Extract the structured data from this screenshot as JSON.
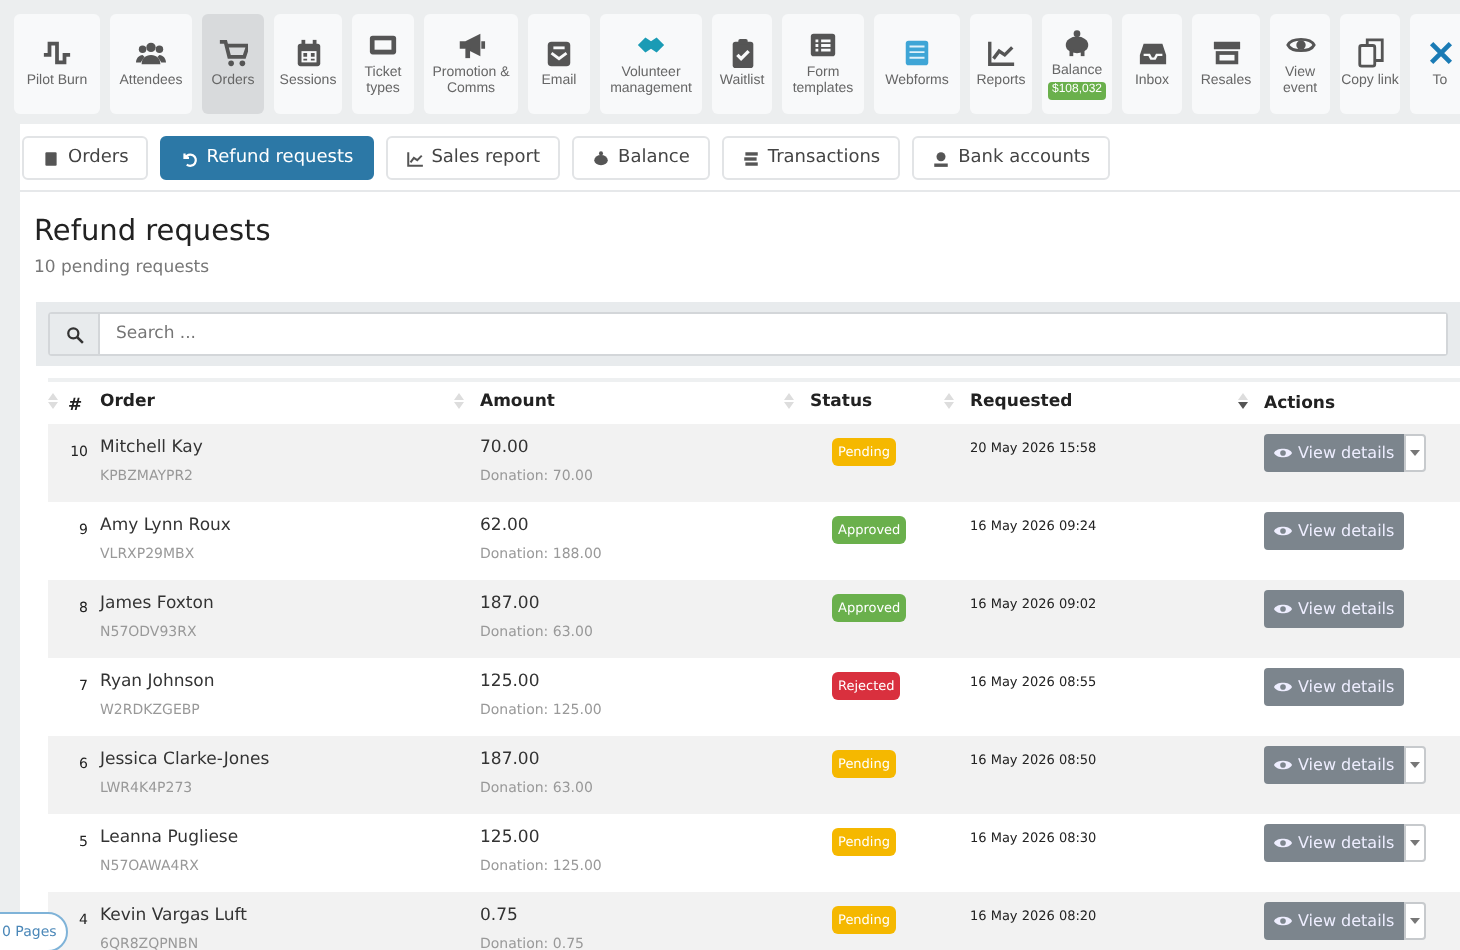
{
  "toolbar": [
    {
      "label": "Pilot Burn",
      "selected": false
    },
    {
      "label": "Attendees",
      "selected": false
    },
    {
      "label": "Orders",
      "selected": true
    },
    {
      "label": "Sessions",
      "selected": false
    },
    {
      "label": "Ticket types",
      "selected": false
    },
    {
      "label": "Promotion & Comms",
      "selected": false
    },
    {
      "label": "Email",
      "selected": false
    },
    {
      "label": "Volunteer management",
      "selected": false
    },
    {
      "label": "Waitlist",
      "selected": false
    },
    {
      "label": "Form templates",
      "selected": false
    },
    {
      "label": "Webforms",
      "selected": false
    },
    {
      "label": "Reports",
      "selected": false
    },
    {
      "label": "Balance",
      "badge": "$108,032",
      "selected": false
    },
    {
      "label": "Inbox",
      "selected": false
    },
    {
      "label": "Resales",
      "selected": false
    },
    {
      "label": "View event",
      "selected": false
    },
    {
      "label": "Copy link",
      "selected": false
    },
    {
      "label": "To",
      "selected": false
    }
  ],
  "tabs": [
    {
      "label": "Orders",
      "selected": false
    },
    {
      "label": "Refund requests",
      "selected": true
    },
    {
      "label": "Sales report",
      "selected": false
    },
    {
      "label": "Balance",
      "selected": false
    },
    {
      "label": "Transactions",
      "selected": false
    },
    {
      "label": "Bank accounts",
      "selected": false
    }
  ],
  "page": {
    "title": "Refund requests",
    "subtitle": "10 pending requests"
  },
  "search": {
    "placeholder": "Search ..."
  },
  "table": {
    "columns": [
      {
        "label": "#",
        "sortable": true,
        "sorted": false
      },
      {
        "label": "Order",
        "sortable": true,
        "sorted": false
      },
      {
        "label": "Amount",
        "sortable": true,
        "sorted": false
      },
      {
        "label": "Status",
        "sortable": true,
        "sorted": false
      },
      {
        "label": "Requested",
        "sortable": true,
        "sorted": true
      },
      {
        "label": "Actions",
        "sortable": false
      }
    ],
    "rows": [
      {
        "number": "10",
        "name": "Mitchell Kay",
        "code": "KPBZMAYPR2",
        "amount": "70.00",
        "donation": "Donation: 70.00",
        "status": "Pending",
        "kind": "pending",
        "requested": "20 May 2026 15:58",
        "action": "View details",
        "dropdown": true
      },
      {
        "number": "9",
        "name": "Amy Lynn Roux",
        "code": "VLRXP29MBX",
        "amount": "62.00",
        "donation": "Donation: 188.00",
        "status": "Approved",
        "kind": "approved",
        "requested": "16 May 2026 09:24",
        "action": "View details",
        "dropdown": false
      },
      {
        "number": "8",
        "name": "James Foxton",
        "code": "N57ODV93RX",
        "amount": "187.00",
        "donation": "Donation: 63.00",
        "status": "Approved",
        "kind": "approved",
        "requested": "16 May 2026 09:02",
        "action": "View details",
        "dropdown": false
      },
      {
        "number": "7",
        "name": "Ryan Johnson",
        "code": "W2RDKZGEBP",
        "amount": "125.00",
        "donation": "Donation: 125.00",
        "status": "Rejected",
        "kind": "rejected",
        "requested": "16 May 2026 08:55",
        "action": "View details",
        "dropdown": false
      },
      {
        "number": "6",
        "name": "Jessica Clarke-Jones",
        "code": "LWR4K4P273",
        "amount": "187.00",
        "donation": "Donation: 63.00",
        "status": "Pending",
        "kind": "pending",
        "requested": "16 May 2026 08:50",
        "action": "View details",
        "dropdown": true
      },
      {
        "number": "5",
        "name": "Leanna Pugliese",
        "code": "N57OAWA4RX",
        "amount": "125.00",
        "donation": "Donation: 125.00",
        "status": "Pending",
        "kind": "pending",
        "requested": "16 May 2026 08:30",
        "action": "View details",
        "dropdown": true
      },
      {
        "number": "4",
        "name": "Kevin Vargas Luft",
        "code": "6QR8ZQPNBN",
        "amount": "0.75",
        "donation": "Donation: 0.75",
        "status": "Pending",
        "kind": "pending",
        "requested": "16 May 2026 08:20",
        "action": "View details",
        "dropdown": true
      }
    ]
  },
  "pages_badge": "0 Pages"
}
